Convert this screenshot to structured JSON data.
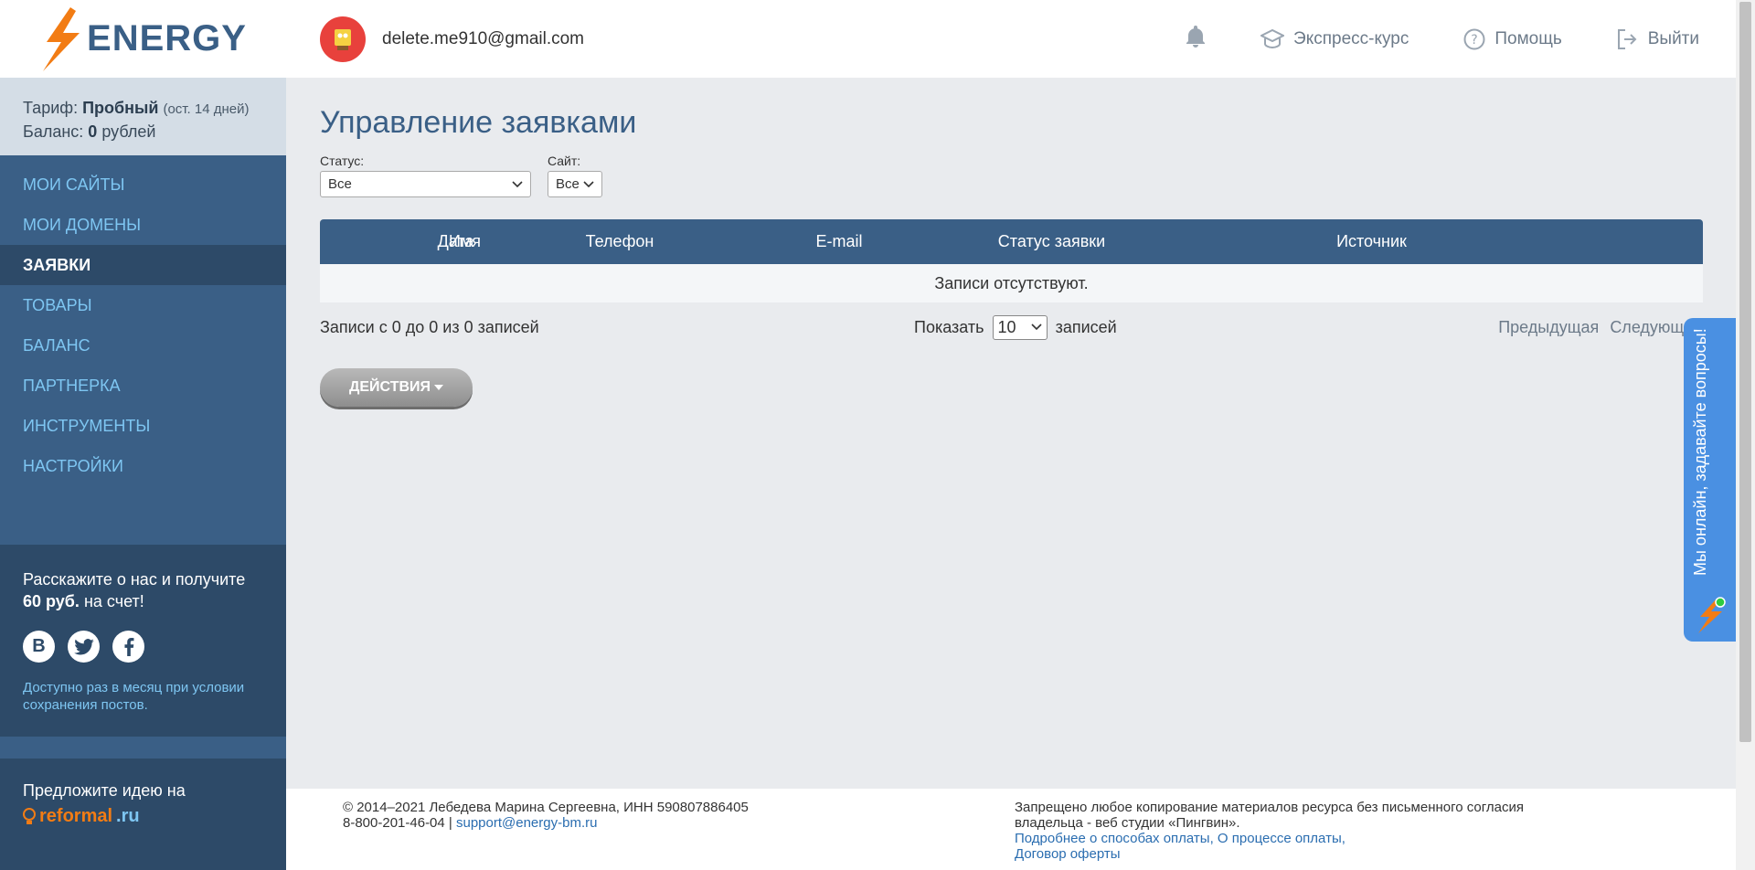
{
  "brand": {
    "logo_text": "ENERGY",
    "accent": "#3a5f86",
    "bolt_color": "#f27c14"
  },
  "tariff": {
    "label": "Тариф:",
    "plan": "Пробный",
    "remaining": "(ост. 14 дней)",
    "balance_label": "Баланс:",
    "balance_value": "0",
    "balance_unit": "рублей"
  },
  "sidebar": {
    "items": [
      {
        "label": "МОИ САЙТЫ"
      },
      {
        "label": "МОИ ДОМЕНЫ"
      },
      {
        "label": "ЗАЯВКИ",
        "active": true
      },
      {
        "label": "ТОВАРЫ"
      },
      {
        "label": "БАЛАНС"
      },
      {
        "label": "ПАРТНЕРКА"
      },
      {
        "label": "ИНСТРУМЕНТЫ"
      },
      {
        "label": "НАСТРОЙКИ"
      }
    ]
  },
  "promo": {
    "text_pre": "Расскажите о нас и получите",
    "amount": "60 руб.",
    "text_post": "на счет!",
    "social": [
      "vk-icon",
      "twitter-icon",
      "facebook-icon"
    ],
    "vk_letter": "В",
    "note": "Доступно раз в месяц при условии сохранения постов."
  },
  "idea": {
    "text": "Предложите идею на",
    "brand_part1": "reformal",
    "brand_part2": ".ru"
  },
  "header": {
    "email": "delete.me910@gmail.com",
    "express": "Экспресс-курс",
    "help": "Помощь",
    "logout": "Выйти"
  },
  "main": {
    "title": "Управление заявками",
    "filters": {
      "status_label": "Статус:",
      "status_value": "Все",
      "site_label": "Сайт:",
      "site_value": "Все"
    },
    "table": {
      "columns": [
        "Дата",
        "Имя",
        "Телефон",
        "E-mail",
        "Статус заявки",
        "Источник"
      ],
      "empty": "Записи отсутствуют."
    },
    "info": "Записи с 0 до 0 из 0 записей",
    "show_label": "Показать",
    "page_size": "10",
    "show_unit": "записей",
    "prev": "Предыдущая",
    "next": "Следующая",
    "actions": "ДЕЙСТВИЯ"
  },
  "footer": {
    "copyright": "© 2014–2021 Лебедева Марина Сергеевна, ИНН 590807886405",
    "phone": "8-800-201-46-04 |",
    "support_email": "support@energy-bm.ru",
    "notice": "Запрещено любое копирование материалов ресурса без письменного согласия владельца - веб студии «Пингвин».",
    "pay_methods": "Подробнее о способах оплаты,",
    "pay_process": "О процессе оплаты,",
    "offer": "Договор оферты"
  },
  "chat": {
    "text": "Мы онлайн, задавайте вопросы!"
  }
}
